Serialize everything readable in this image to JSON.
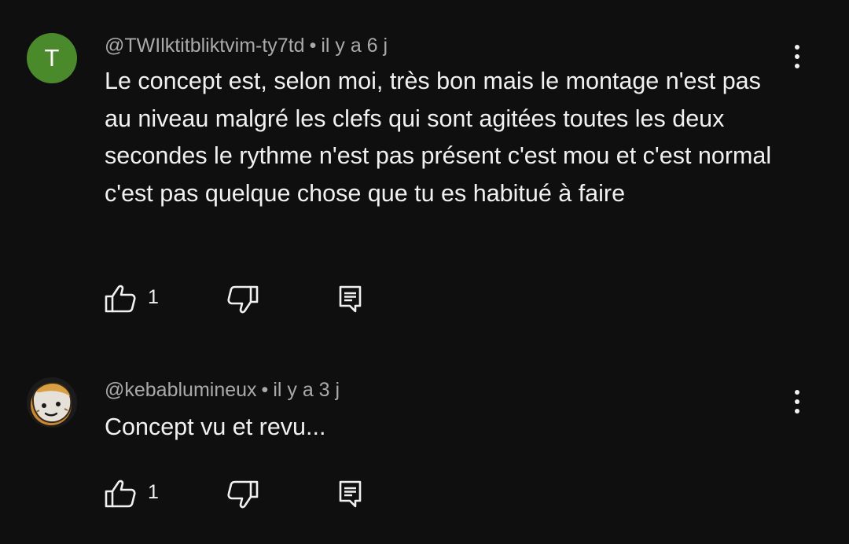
{
  "comments": [
    {
      "avatar_letter": "T",
      "avatar_color": "#4a8a2a",
      "author": "@TWIlktitbliktvim-ty7td",
      "separator": "•",
      "time": "il y a 6 j",
      "text": "Le concept est, selon moi, très bon mais le montage n'est pas au niveau malgré les clefs qui sont agitées toutes les deux secondes le rythme n'est pas présent c'est mou et c'est normal c'est pas quelque chose que tu es habitué à faire",
      "likes": "1"
    },
    {
      "avatar_letter": "",
      "author": "@kebablumineux",
      "separator": "•",
      "time": "il y a 3 j",
      "text": "Concept vu et revu...",
      "likes": "1"
    }
  ],
  "icons": {
    "like": "thumb-up-icon",
    "dislike": "thumb-down-icon",
    "reply": "reply-icon",
    "more": "more-vert-icon"
  },
  "colors": {
    "background": "#0f0f0f",
    "primary_text": "#f1f1f1",
    "secondary_text": "#aaaaaa"
  }
}
